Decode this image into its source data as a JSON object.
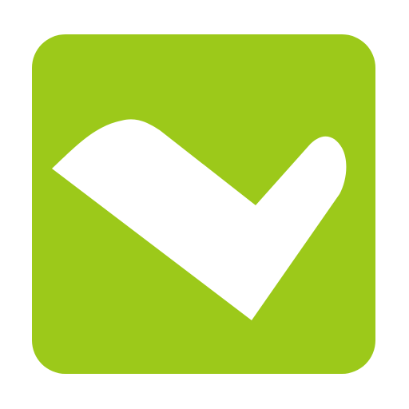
{
  "icon": {
    "name": "checkmark-icon",
    "background_color": "#9cc91a",
    "check_color": "#ffffff"
  }
}
